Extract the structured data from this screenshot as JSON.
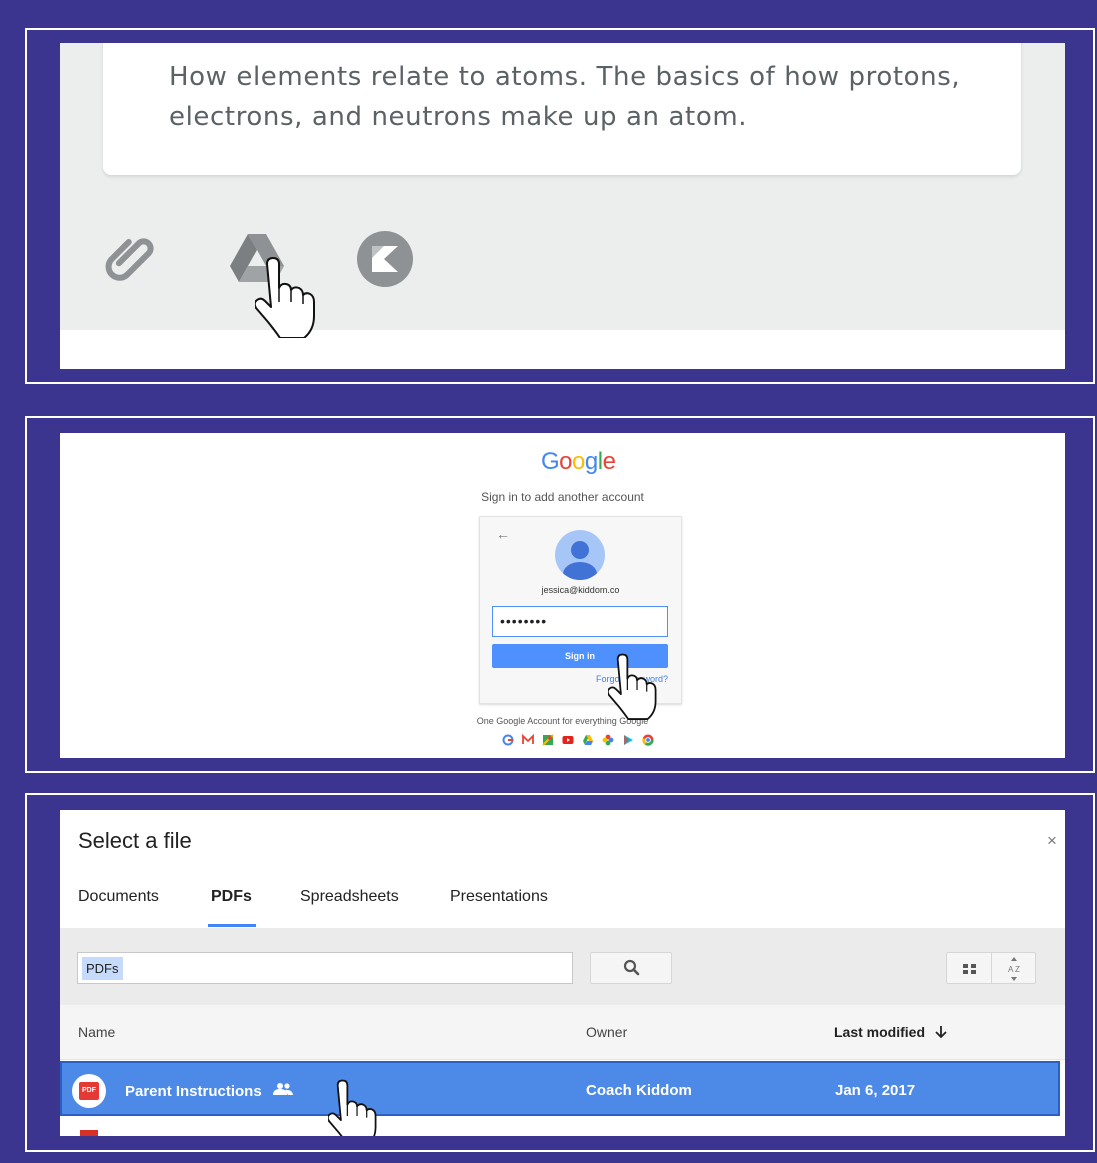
{
  "panel1": {
    "description": "How elements relate to atoms. The basics of how protons, electrons, and neutrons make up an atom.",
    "icons": [
      "paperclip-icon",
      "google-drive-icon",
      "kiddom-icon"
    ]
  },
  "panel2": {
    "logo": {
      "letters": [
        "G",
        "o",
        "o",
        "g",
        "l",
        "e"
      ],
      "colors": [
        "#4285f4",
        "#ea4335",
        "#fbbc05",
        "#4285f4",
        "#34a853",
        "#ea4335"
      ]
    },
    "subtitle": "Sign in to add another account",
    "back_arrow": "←",
    "email": "jessica@kiddom.co",
    "password_mask": "••••••••",
    "signin_label": "Sign in",
    "forgot_label": "Forgot password?",
    "footer": "One Google Account for everything Google"
  },
  "panel3": {
    "title": "Select a file",
    "close": "×",
    "tabs": [
      {
        "label": "Documents"
      },
      {
        "label": "PDFs"
      },
      {
        "label": "Spreadsheets"
      },
      {
        "label": "Presentations"
      }
    ],
    "active_tab": "PDFs",
    "search_chip": "PDFs",
    "columns": {
      "name": "Name",
      "owner": "Owner",
      "modified": "Last modified"
    },
    "rows": [
      {
        "name": "Parent Instructions",
        "owner": "Coach Kiddom",
        "modified": "Jan 6, 2017",
        "badge": "PDF"
      }
    ]
  }
}
